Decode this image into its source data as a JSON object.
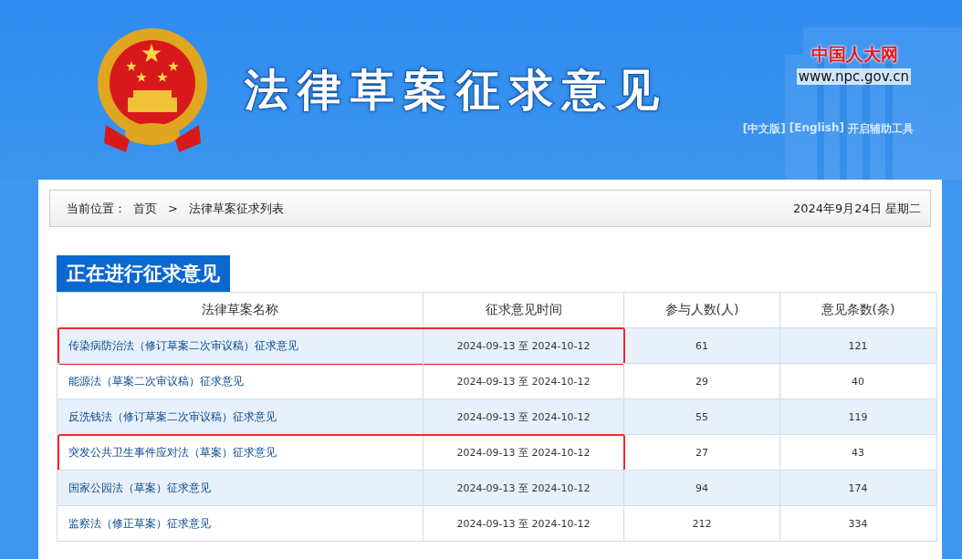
{
  "header": {
    "title": "法律草案征求意见",
    "site_name": "中国人大网",
    "site_url": "www.npc.gov.cn",
    "links": [
      "[中文版]",
      "[English]",
      "开启辅助工具"
    ]
  },
  "breadcrumb": {
    "label": "当前位置：",
    "items": [
      "首页",
      "法律草案征求列表"
    ],
    "separator": ">",
    "date": "2024年9月24日  星期二"
  },
  "section_title": "正在进行征求意见",
  "table": {
    "columns": [
      "法律草案名称",
      "征求意见时间",
      "参与人数(人)",
      "意见条数(条)"
    ],
    "rows": [
      {
        "name": "传染病防治法（修订草案二次审议稿）征求意见",
        "period": "2024-09-13 至 2024-10-12",
        "participants": "61",
        "comments": "121",
        "highlighted": true
      },
      {
        "name": "能源法（草案二次审议稿）征求意见",
        "period": "2024-09-13 至 2024-10-12",
        "participants": "29",
        "comments": "40",
        "highlighted": false
      },
      {
        "name": "反洗钱法（修订草案二次审议稿）征求意见",
        "period": "2024-09-13 至 2024-10-12",
        "participants": "55",
        "comments": "119",
        "highlighted": false
      },
      {
        "name": "突发公共卫生事件应对法（草案）征求意见",
        "period": "2024-09-13 至 2024-10-12",
        "participants": "27",
        "comments": "43",
        "highlighted": true
      },
      {
        "name": "国家公园法（草案）征求意见",
        "period": "2024-09-13 至 2024-10-12",
        "participants": "94",
        "comments": "174",
        "highlighted": false
      },
      {
        "name": "监察法（修正草案）征求意见",
        "period": "2024-09-13 至 2024-10-12",
        "participants": "212",
        "comments": "334",
        "highlighted": false
      }
    ]
  }
}
